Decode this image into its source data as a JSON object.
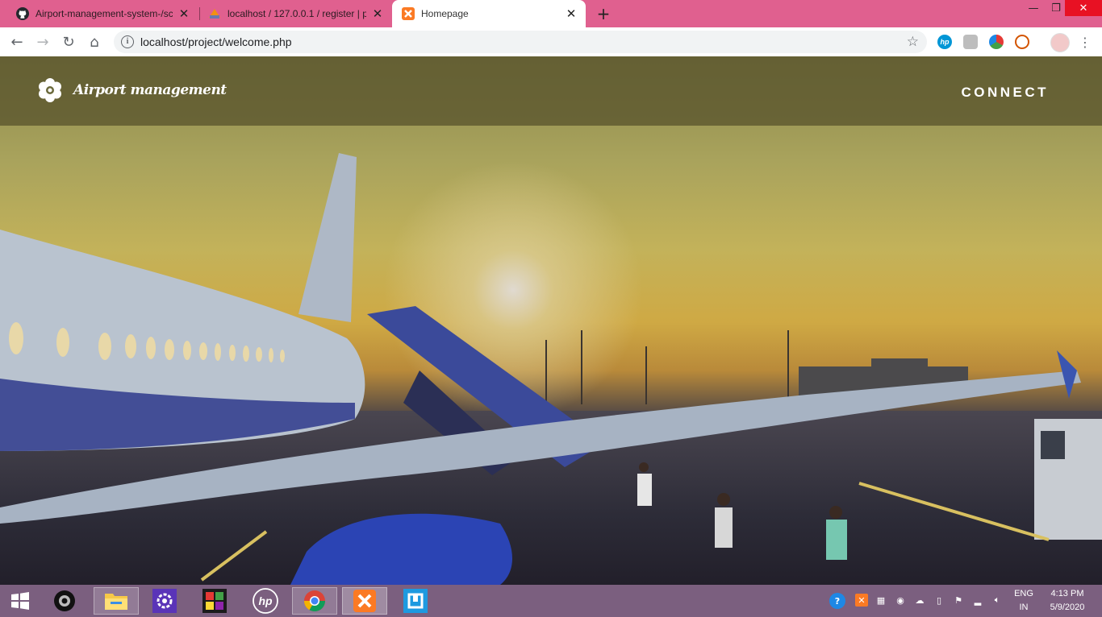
{
  "browser": {
    "tabs": [
      {
        "title": "Airport-management-system-/sc",
        "favicon": "github-icon",
        "active": false
      },
      {
        "title": "localhost / 127.0.0.1 / register | p",
        "favicon": "phpmyadmin-icon",
        "active": false
      },
      {
        "title": "Homepage",
        "favicon": "xampp-icon",
        "active": true
      }
    ],
    "new_tab": "+",
    "address": "localhost/project/welcome.php"
  },
  "page": {
    "brand": "Airport management",
    "nav_link": "CONNECT",
    "hero_image": "airplane at sunset on airport tarmac"
  },
  "taskbar": {
    "apps": [
      "start-icon",
      "camera-app-icon",
      "file-explorer-icon",
      "settings-icon",
      "puzzle-app-icon",
      "hp-icon",
      "chrome-icon",
      "xampp-icon",
      "code-editor-icon"
    ],
    "language": {
      "line1": "ENG",
      "line2": "IN"
    },
    "clock": {
      "time": "4:13 PM",
      "date": "5/9/2020"
    }
  },
  "colors": {
    "tab_strip": "#e0608f",
    "taskbar": "#7b5f7f",
    "navbar_overlay": "#5a552d"
  }
}
